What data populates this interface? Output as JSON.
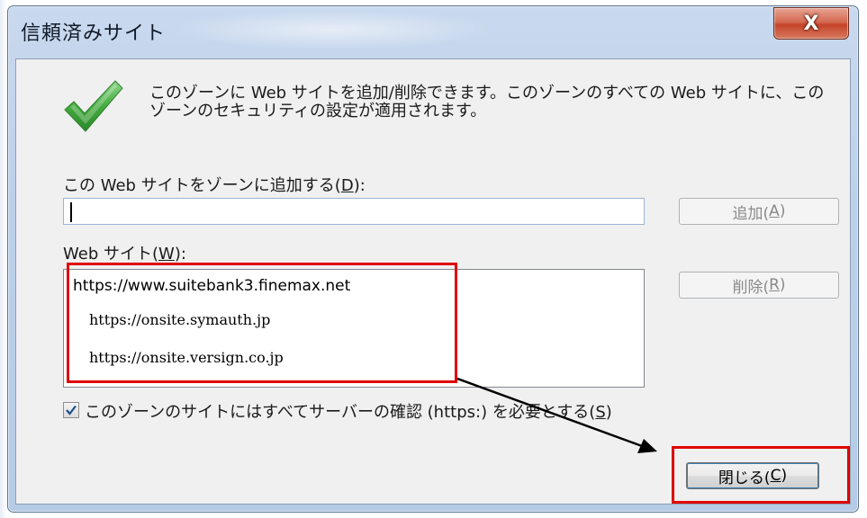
{
  "window": {
    "title": "信頼済みサイト",
    "close_glyph": "X"
  },
  "dialog": {
    "description": "このゾーンに Web サイトを追加/削除できます。このゾーンのすべての Web サイトに、このゾーンのセキュリティの設定が適用されます。",
    "add_label": "この Web サイトをゾーンに追加する(",
    "add_label_key": "D",
    "add_label_end": "):",
    "add_input_value": "",
    "add_button_label": "追加(",
    "add_button_key": "A",
    "add_button_end": ")",
    "sites_label": "Web サイト(",
    "sites_label_key": "W",
    "sites_label_end": "):",
    "sites": [
      "https://www.suitebank3.finemax.net",
      "https://onsite.symauth.jp",
      "https://onsite.versign.co.jp"
    ],
    "remove_button_label": "削除(",
    "remove_button_key": "R",
    "remove_button_end": ")",
    "require_https_label": "このゾーンのサイトにはすべてサーバーの確認 (https:) を必要とする(",
    "require_https_key": "S",
    "require_https_end": ")",
    "require_https_checked": true,
    "close_button_label": "閉じる(",
    "close_button_key": "C",
    "close_button_end": ")"
  },
  "icons": {
    "status": "checkmark-icon",
    "checkbox": "checkbox-checked-icon"
  },
  "colors": {
    "highlight_box": "#e00000",
    "checkmark": "#3aa23a",
    "titlebar_close": "#c5442a"
  }
}
